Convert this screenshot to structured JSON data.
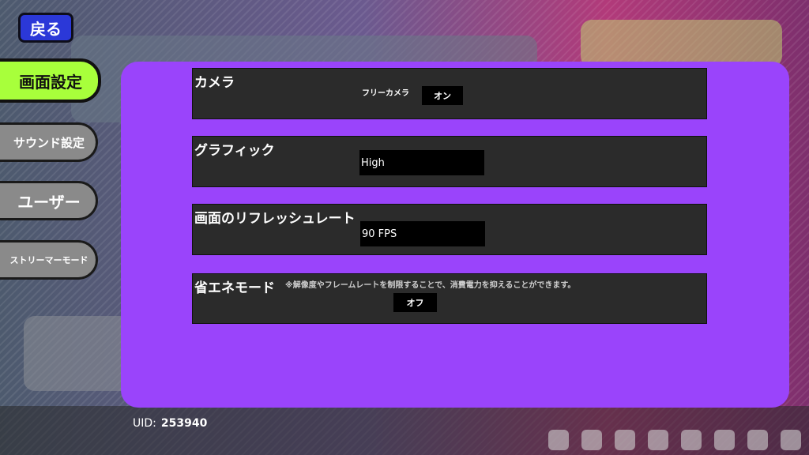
{
  "nav": {
    "back_label": "戻る",
    "tabs": [
      {
        "label": "画面設定",
        "active": true
      },
      {
        "label": "サウンド設定"
      },
      {
        "label": "ユーザー"
      },
      {
        "label": "ストリーマーモード"
      }
    ]
  },
  "settings": {
    "camera": {
      "title": "カメラ",
      "free_camera_label": "フリーカメラ",
      "free_camera_value": "オン"
    },
    "graphics": {
      "title": "グラフィック",
      "value": "High"
    },
    "refresh_rate": {
      "title": "画面のリフレッシュレート",
      "value": "90 FPS"
    },
    "power_saving": {
      "title": "省エネモード",
      "note": "※解像度やフレームレートを制限することで、消費電力を抑えることができます。",
      "value": "オフ"
    }
  },
  "footer": {
    "uid_label": "UID:",
    "uid_value": "253940"
  },
  "colors": {
    "panel": "#9a44fb",
    "active_tab": "#a8ff3b",
    "back_button": "#2b38d8"
  }
}
